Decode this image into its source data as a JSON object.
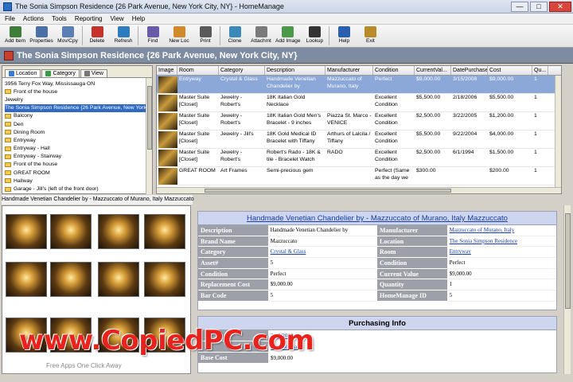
{
  "window": {
    "title": "The Sonia Simpson Residence {26 Park Avenue, New York City, NY} - HomeManage",
    "controls": [
      "—",
      "□",
      "✕"
    ]
  },
  "menu": [
    "File",
    "Actions",
    "Tools",
    "Reporting",
    "View",
    "Help"
  ],
  "toolbar": [
    {
      "label": "Add Item",
      "icon": "add-item-icon",
      "color": "#3f7e3a"
    },
    {
      "label": "Properties",
      "icon": "properties-icon",
      "color": "#4b6fa8"
    },
    {
      "label": "Mov/Cpy",
      "icon": "move-copy-icon",
      "color": "#5a7fb5"
    },
    {
      "label": "Delete",
      "icon": "delete-icon",
      "color": "#c6332a"
    },
    {
      "label": "Refresh",
      "icon": "refresh-icon",
      "color": "#2f7bbf"
    },
    {
      "label": "Find",
      "icon": "find-icon",
      "color": "#6a5aa8"
    },
    {
      "label": "New Loc",
      "icon": "new-location-icon",
      "color": "#d08a2a"
    },
    {
      "label": "Print",
      "icon": "print-icon",
      "color": "#5a5a5a"
    },
    {
      "label": "Clone",
      "icon": "clone-icon",
      "color": "#3a8ab8"
    },
    {
      "label": "Attachmt",
      "icon": "attachment-icon",
      "color": "#7a7a7a"
    },
    {
      "label": "Add Image",
      "icon": "add-image-icon",
      "color": "#4a9a4a"
    },
    {
      "label": "Lookup",
      "icon": "lookup-icon",
      "color": "#333333"
    },
    {
      "label": "Help",
      "icon": "help-icon",
      "color": "#2a5fb0"
    },
    {
      "label": "Exit",
      "icon": "exit-icon",
      "color": "#b88a2a"
    }
  ],
  "header": {
    "title": "The Sonia Simpson Residence {26 Park Avenue, New York City, NY}"
  },
  "left_panel": {
    "tabs": [
      "Location",
      "Category",
      "View"
    ],
    "tree": [
      {
        "label": "3956 Terry Fox Way, Mississauga ON",
        "folder": false
      },
      {
        "label": "Front of the house",
        "folder": true
      },
      {
        "label": "Jewelry",
        "folder": false
      },
      {
        "label": "The Sonia Simpson Residence {26 Park Avenue, New York City, NY}",
        "folder": false,
        "selected": true
      },
      {
        "label": "Balcony",
        "folder": true
      },
      {
        "label": "Den",
        "folder": true
      },
      {
        "label": "Dining Room",
        "folder": true
      },
      {
        "label": "Entryway",
        "folder": true
      },
      {
        "label": "Entryway - Hall",
        "folder": true
      },
      {
        "label": "Entryway - Stairway",
        "folder": true
      },
      {
        "label": "Front of the house",
        "folder": true
      },
      {
        "label": "GREAT ROOM",
        "folder": true
      },
      {
        "label": "Hallway",
        "folder": true
      },
      {
        "label": "Garage - Jill's (left of the front door)",
        "folder": true
      }
    ]
  },
  "grid": {
    "columns": [
      "Image",
      "Room",
      "Category",
      "Description",
      "Manufacturer",
      "Condition",
      "CurrentVal...",
      "DatePurchase",
      "Cost",
      "Qu..."
    ],
    "rows": [
      {
        "room": "Entryway",
        "category": "Crystal & Glass",
        "description": "Handmade Venetian Chandelier by",
        "manufacturer": "Mazzuccato of Murano, Italy",
        "condition": "Perfect",
        "value": "$9,000.00",
        "date": "3/15/2008",
        "cost": "$9,000.00",
        "qty": "1",
        "selected": true
      },
      {
        "room": "Master Suite [Closet]",
        "category": "Jewelry - Robert's",
        "description": "18K Italian Gold Necklace",
        "manufacturer": "",
        "condition": "Excellent Condition",
        "value": "$5,500.00",
        "date": "2/18/2006",
        "cost": "$5,500.00",
        "qty": "1"
      },
      {
        "room": "Master Suite [Closet]",
        "category": "Jewelry - Robert's",
        "description": "18K Italian Gold Men's Bracelet - 9 inches",
        "manufacturer": "Piazza St. Marco - VENICE",
        "condition": "Excellent Condition",
        "value": "$2,500.00",
        "date": "3/22/2005",
        "cost": "$1,200.00",
        "qty": "1"
      },
      {
        "room": "Master Suite [Closet]",
        "category": "Jewelry - Jill's",
        "description": "18K Gold Medical ID Bracelet with Tiffany",
        "manufacturer": "Arthurs of Lalcila / Tiffany",
        "condition": "Excellent Condition",
        "value": "$5,500.00",
        "date": "9/22/2004",
        "cost": "$4,000.00",
        "qty": "1"
      },
      {
        "room": "Master Suite [Closet]",
        "category": "Jewelry - Robert's",
        "description": "Robert's Rado - 18K & tile - Bracelet Watch",
        "manufacturer": "RADO",
        "condition": "Excellent Condition",
        "value": "$2,500.00",
        "date": "6/1/1994",
        "cost": "$1,500.00",
        "qty": "1"
      },
      {
        "room": "GREAT ROOM",
        "category": "Art Frames",
        "description": "Semi-precious gem",
        "manufacturer": "",
        "condition": "Perfect (Same as the day we",
        "value": "$300.00",
        "date": "",
        "cost": "$200.00",
        "qty": "1"
      }
    ]
  },
  "caption": "Handmade Venetian Chandelier by  - Mazzuccato of Murano, Italy  Mazzuccato",
  "details": {
    "title": "Handmade Venetian Chandelier by - Mazzuccato of Murano, Italy Mazzuccato",
    "left": [
      {
        "label": "Description",
        "value": "Handmade Venetian Chandelier by",
        "link": false
      },
      {
        "label": "Brand Name",
        "value": "Mazzuccato",
        "link": false
      },
      {
        "label": "Category",
        "value": "Crystal & Glass",
        "link": true
      },
      {
        "label": "Asset#",
        "value": "5",
        "link": false
      },
      {
        "label": "Condition",
        "value": "Perfect",
        "link": false
      },
      {
        "label": "Replacement Cost",
        "value": "$9,000.00",
        "link": false
      },
      {
        "label": "Bar Code",
        "value": "5",
        "link": false
      }
    ],
    "right": [
      {
        "label": "Manufacturer",
        "value": "Mazzuccato of Murano, Italy",
        "link": true
      },
      {
        "label": "Location",
        "value": "The Sonia Simpson Residence",
        "link": true
      },
      {
        "label": "Room",
        "value": "Entryway",
        "link": true
      },
      {
        "label": "Room",
        "value": "",
        "link": false
      },
      {
        "label": "Condition",
        "value": "Perfect",
        "link": false
      },
      {
        "label": "Current Value",
        "value": "$9,000.00",
        "link": false
      },
      {
        "label": "Quantity",
        "value": "1",
        "link": false
      },
      {
        "label": "HomeManage ID",
        "value": "5",
        "link": false
      }
    ]
  },
  "purchasing": {
    "title": "Purchasing Info",
    "rows": [
      {
        "label": "",
        "value": "3/15/2008",
        "link": true
      },
      {
        "label": "",
        "value": "Murano, Italy",
        "link": true
      },
      {
        "label": "Base Cost",
        "value": "$9,000.00",
        "link": false
      }
    ]
  },
  "watermark": {
    "text": "www.CopiedPC.com",
    "subtext": "Free Apps One Click Away"
  }
}
